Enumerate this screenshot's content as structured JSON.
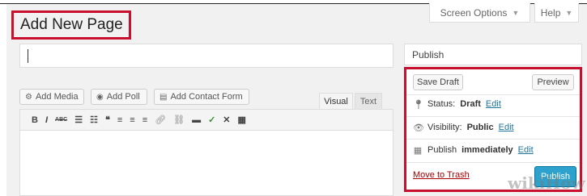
{
  "header": {
    "screen_options": "Screen Options",
    "help": "Help",
    "page_title": "Add New Page"
  },
  "title_input": {
    "value": ""
  },
  "media_buttons": {
    "add_media": "Add Media",
    "add_poll": "Add Poll",
    "add_contact_form": "Add Contact Form"
  },
  "editor_tabs": {
    "visual": "Visual",
    "text": "Text"
  },
  "toolbar": {
    "items": [
      "B",
      "I",
      "ABC",
      "list-ul",
      "list-ol",
      "quote",
      "align-left",
      "align-center",
      "align-right",
      "link",
      "unlink",
      "more",
      "spellcheck",
      "fullscreen",
      "kitchen-sink"
    ]
  },
  "publish": {
    "title": "Publish",
    "save_draft": "Save Draft",
    "preview": "Preview",
    "status_label": "Status:",
    "status_value": "Draft",
    "visibility_label": "Visibility:",
    "visibility_value": "Public",
    "publish_label": "Publish",
    "publish_value": "immediately",
    "edit": "Edit",
    "move_to_trash": "Move to Trash",
    "publish_button": "Publish"
  },
  "watermark": "wikiHow",
  "colors": {
    "highlight": "#c8102e",
    "primary_button": "#2ea2cc",
    "link": "#21759b",
    "trash": "#a00000"
  }
}
